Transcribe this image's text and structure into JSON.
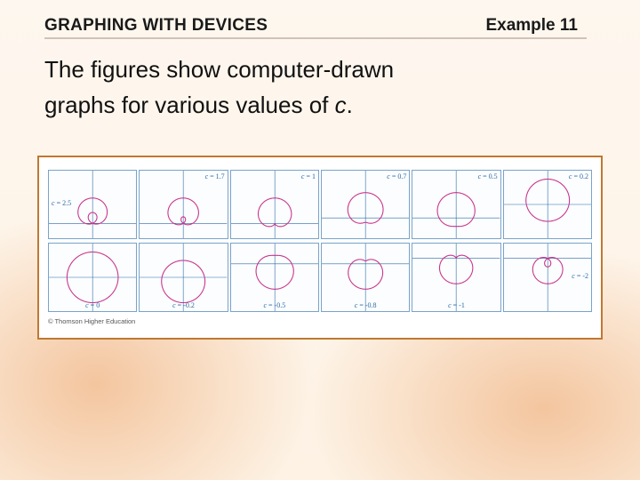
{
  "header": {
    "section_title": "GRAPHING WITH DEVICES",
    "example_label": "Example 11"
  },
  "body": {
    "line1": "The figures show computer-drawn",
    "line2_a": "graphs for various values of ",
    "line2_c": "c",
    "line2_b": "."
  },
  "figure": {
    "credit": "© Thomson Higher Education"
  },
  "chart_data": {
    "type": "table",
    "description": "Polar curves r = 1 + c·sinθ for a sequence of c values",
    "cells": [
      {
        "row": 0,
        "col": 0,
        "c": 2.5,
        "label": "c = 2.5",
        "label_pos": "left-mid"
      },
      {
        "row": 0,
        "col": 1,
        "c": 1.7,
        "label": "c = 1.7",
        "label_pos": "top-right"
      },
      {
        "row": 0,
        "col": 2,
        "c": 1.0,
        "label": "c = 1",
        "label_pos": "top-right"
      },
      {
        "row": 0,
        "col": 3,
        "c": 0.7,
        "label": "c = 0.7",
        "label_pos": "top-right"
      },
      {
        "row": 0,
        "col": 4,
        "c": 0.5,
        "label": "c = 0.5",
        "label_pos": "top-right"
      },
      {
        "row": 0,
        "col": 5,
        "c": 0.2,
        "label": "c = 0.2",
        "label_pos": "top-right"
      },
      {
        "row": 1,
        "col": 0,
        "c": 0.0,
        "label": "c = 0",
        "label_pos": "bot-center"
      },
      {
        "row": 1,
        "col": 1,
        "c": -0.2,
        "label": "c = -0.2",
        "label_pos": "bot-center"
      },
      {
        "row": 1,
        "col": 2,
        "c": -0.5,
        "label": "c = -0.5",
        "label_pos": "bot-center"
      },
      {
        "row": 1,
        "col": 3,
        "c": -0.8,
        "label": "c = -0.8",
        "label_pos": "bot-center"
      },
      {
        "row": 1,
        "col": 4,
        "c": -1.0,
        "label": "c = -1",
        "label_pos": "bot-center"
      },
      {
        "row": 1,
        "col": 5,
        "c": -2.0,
        "label": "c = -2",
        "label_pos": "right-mid"
      }
    ],
    "axis_range": {
      "x": [
        -4,
        4
      ],
      "y": [
        -2,
        4
      ]
    }
  }
}
